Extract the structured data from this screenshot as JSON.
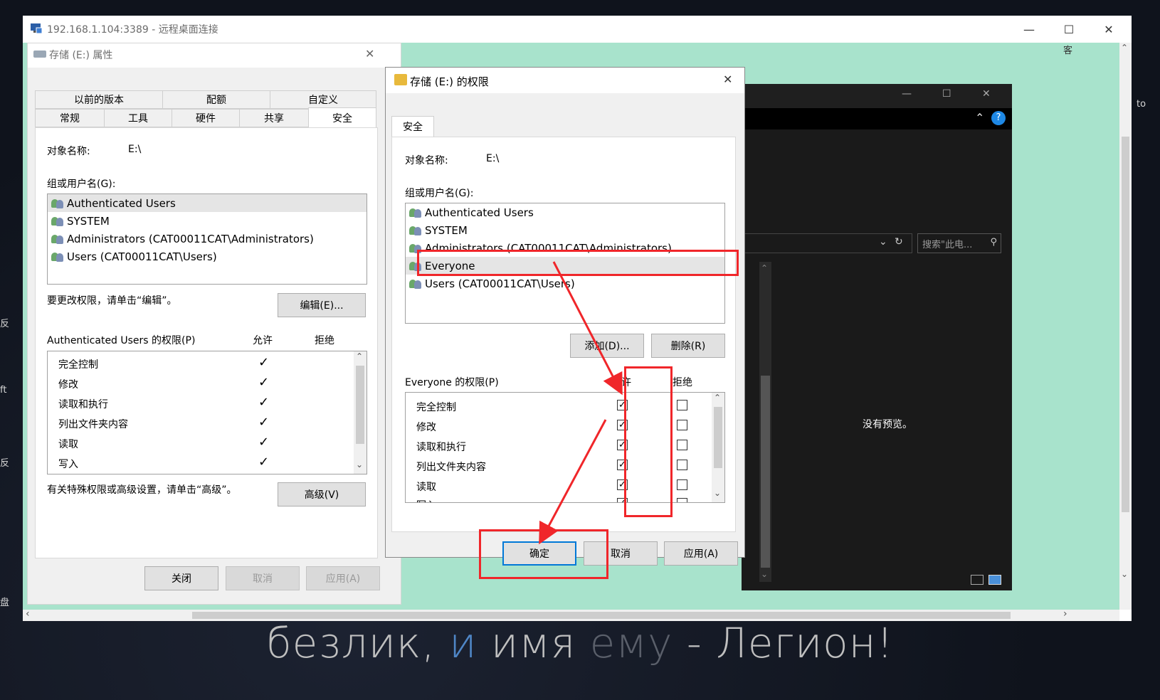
{
  "rdp": {
    "title": "192.168.1.104:3389 - 远程桌面连接"
  },
  "desktop_fragments": [
    "反",
    "ft",
    "反",
    "盘",
    "to",
    "客"
  ],
  "properties": {
    "title": "存储 (E:) 属性",
    "tabs_row1": [
      "以前的版本",
      "配额",
      "自定义"
    ],
    "tabs_row2": [
      "常规",
      "工具",
      "硬件",
      "共享",
      "安全"
    ],
    "object_label": "对象名称:",
    "object_value": "E:\\",
    "group_label": "组或用户名(G):",
    "users": [
      "Authenticated Users",
      "SYSTEM",
      "Administrators (CAT00011CAT\\Administrators)",
      "Users (CAT00011CAT\\Users)"
    ],
    "edit_hint": "要更改权限，请单击“编辑”。",
    "edit_button": "编辑(E)...",
    "perm_header": "Authenticated Users 的权限(P)",
    "allow": "允许",
    "deny": "拒绝",
    "perms": [
      "完全控制",
      "修改",
      "读取和执行",
      "列出文件夹内容",
      "读取",
      "写入"
    ],
    "check": "✓",
    "advanced_hint": "有关特殊权限或高级设置，请单击“高级”。",
    "advanced_button": "高级(V)",
    "close_button": "关闭",
    "cancel_button": "取消",
    "apply_button": "应用(A)"
  },
  "permissions": {
    "title": "存储 (E:) 的权限",
    "tab": "安全",
    "object_label": "对象名称:",
    "object_value": "E:\\",
    "group_label": "组或用户名(G):",
    "users": [
      "Authenticated Users",
      "SYSTEM",
      "Administrators (CAT00011CAT\\Administrators)",
      "Everyone",
      "Users (CAT00011CAT\\Users)"
    ],
    "add_button": "添加(D)...",
    "remove_button": "删除(R)",
    "perm_header": "Everyone 的权限(P)",
    "allow": "允许",
    "deny": "拒绝",
    "perms": [
      "完全控制",
      "修改",
      "读取和执行",
      "列出文件夹内容",
      "读取",
      "写入"
    ],
    "ok_button": "确定",
    "cancel_button": "取消",
    "apply_button": "应用(A)"
  },
  "explorer": {
    "search_placeholder": "搜索\"此电...",
    "no_preview": "没有预览。"
  },
  "caption": {
    "part1": "безлик, ",
    "part2": "и",
    "part3": " имя ",
    "part4": "ему",
    "part5": " - Легион!"
  },
  "colors": {
    "highlight": "#f0262a",
    "remote_bg": "#a8e3cc",
    "accent": "#0078d7"
  }
}
